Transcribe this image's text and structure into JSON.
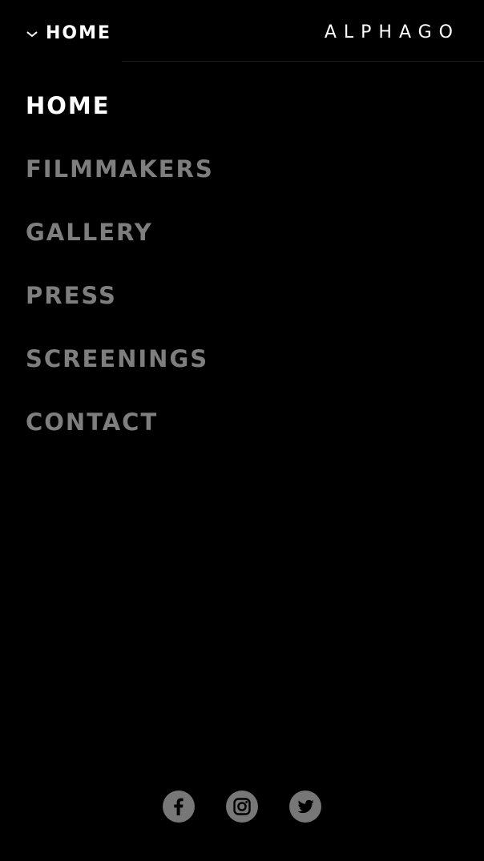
{
  "header": {
    "current_section": "HOME",
    "logo": "ALPHAGO",
    "toggle_icon": "chevron-down-icon"
  },
  "menu": {
    "items": [
      {
        "label": "HOME",
        "active": true
      },
      {
        "label": "FILMMAKERS",
        "active": false
      },
      {
        "label": "GALLERY",
        "active": false
      },
      {
        "label": "PRESS",
        "active": false
      },
      {
        "label": "SCREENINGS",
        "active": false
      },
      {
        "label": "CONTACT",
        "active": false
      }
    ]
  },
  "social": {
    "icons": [
      "facebook-icon",
      "instagram-icon",
      "twitter-icon"
    ]
  },
  "colors": {
    "background": "#000000",
    "active_text": "#ffffff",
    "inactive_text": "#7e7e7e",
    "social_bg": "#777777"
  }
}
